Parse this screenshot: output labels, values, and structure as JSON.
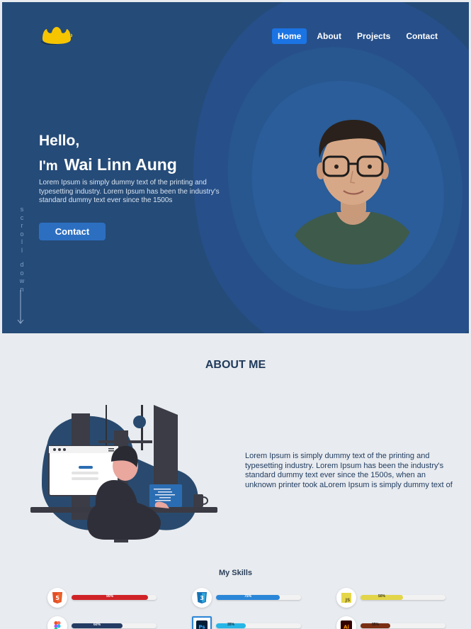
{
  "nav": {
    "items": [
      {
        "label": "Home",
        "active": true
      },
      {
        "label": "About",
        "active": false
      },
      {
        "label": "Projects",
        "active": false
      },
      {
        "label": "Contact",
        "active": false
      }
    ]
  },
  "hero": {
    "greeting": "Hello,",
    "intro": "I'm",
    "name": "Wai Linn Aung",
    "description": "Lorem Ipsum is simply dummy text of the printing and typesetting industry. Lorem Ipsum has been the industry's standard dummy text ever since the 1500s",
    "button_label": "Contact",
    "scroll_word1": "scroll",
    "scroll_word2": "down"
  },
  "about": {
    "title": "ABOUT ME",
    "text": "Lorem Ipsum is simply dummy text of the printing and typesetting industry. Lorem Ipsum has been the industry's standard dummy text ever since the 1500s, when an unknown printer took aLorem Ipsum is simply dummy text of"
  },
  "skills": {
    "title": "My Skills",
    "items": [
      {
        "icon": "html5-icon",
        "percent": "90%",
        "level": 0.9,
        "color": "#cf2328"
      },
      {
        "icon": "css3-icon",
        "percent": "75%",
        "level": 0.75,
        "color": "#2b86d8"
      },
      {
        "icon": "javascript-icon",
        "percent": "50%",
        "level": 0.5,
        "color": "#e2d54a"
      },
      {
        "icon": "figma-icon",
        "percent": "60%",
        "level": 0.6,
        "color": "#243c63"
      },
      {
        "icon": "photoshop-icon",
        "percent": "35%",
        "level": 0.35,
        "color": "#27b6e6"
      },
      {
        "icon": "illustrator-icon",
        "percent": "35%",
        "level": 0.35,
        "color": "#7a2e12"
      }
    ]
  },
  "colors": {
    "hero_bg": "#254b78",
    "accent": "#1b74e4",
    "button": "#2c6fc1",
    "logo": "#f6c500",
    "heading": "#1f3a5a"
  }
}
